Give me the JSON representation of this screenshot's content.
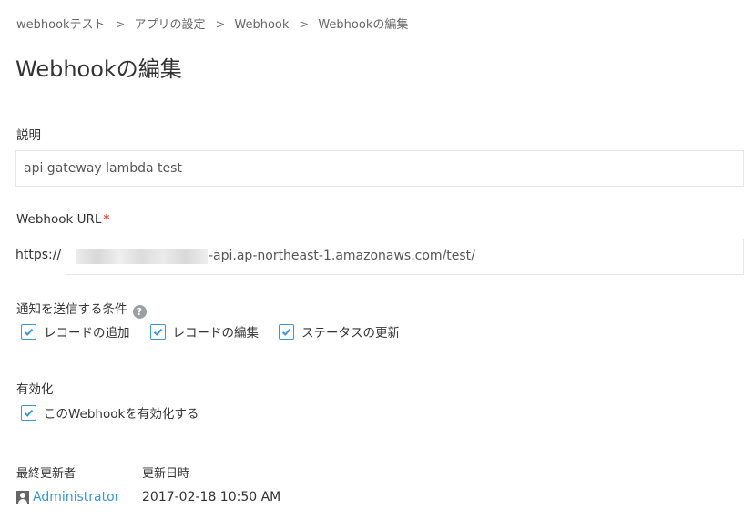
{
  "breadcrumb": {
    "items": [
      "webhookテスト",
      "アプリの設定",
      "Webhook",
      "Webhookの編集"
    ],
    "separator": ">"
  },
  "page": {
    "title": "Webhookの編集"
  },
  "description": {
    "label": "説明",
    "value": "api gateway lambda test"
  },
  "webhook_url": {
    "label": "Webhook URL",
    "required_mark": "*",
    "prefix": "https://",
    "value_visible": "-api.ap-northeast-1.amazonaws.com/test/"
  },
  "conditions": {
    "label": "通知を送信する条件",
    "help_icon": "question-icon",
    "options": [
      {
        "label": "レコードの追加",
        "checked": true
      },
      {
        "label": "レコードの編集",
        "checked": true
      },
      {
        "label": "ステータスの更新",
        "checked": true
      }
    ]
  },
  "enable": {
    "label": "有効化",
    "option": {
      "label": "このWebhookを有効化する",
      "checked": true
    }
  },
  "meta": {
    "updated_by_label": "最終更新者",
    "updated_at_label": "更新日時",
    "updated_by": "Administrator",
    "updated_at": "2017-02-18 10:50 AM"
  },
  "colors": {
    "accent": "#3498db",
    "required": "#e74c3c",
    "border": "#e3e7e8"
  }
}
